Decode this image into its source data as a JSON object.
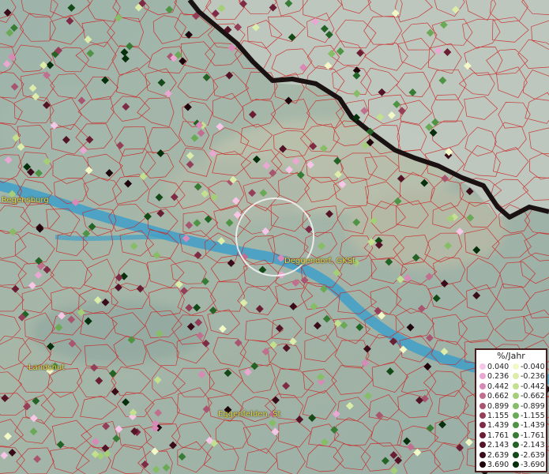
{
  "places": [
    {
      "name": "Regensburg"
    },
    {
      "name": "Deggendorf, GKSt"
    },
    {
      "name": "Landshut"
    },
    {
      "name": "Eggenfelden, St"
    }
  ],
  "legend": {
    "title": "%/Jahr",
    "positive": [
      {
        "value": "0.040",
        "color": "#f5c6e6"
      },
      {
        "value": "0.236",
        "color": "#e8a8d2"
      },
      {
        "value": "0.442",
        "color": "#d88ab6"
      },
      {
        "value": "0.662",
        "color": "#c0708f"
      },
      {
        "value": "0.899",
        "color": "#a85670"
      },
      {
        "value": "1.155",
        "color": "#943e58"
      },
      {
        "value": "1.439",
        "color": "#7e2b45"
      },
      {
        "value": "1.761",
        "color": "#6a1e34"
      },
      {
        "value": "2.143",
        "color": "#521426"
      },
      {
        "value": "2.639",
        "color": "#3a0c19"
      },
      {
        "value": "3.690",
        "color": "#1f050c"
      }
    ],
    "negative": [
      {
        "value": "-0.040",
        "color": "#f2f8c6"
      },
      {
        "value": "-0.236",
        "color": "#dcedaa"
      },
      {
        "value": "-0.442",
        "color": "#c2e08e"
      },
      {
        "value": "-0.662",
        "color": "#a4cf78"
      },
      {
        "value": "-0.899",
        "color": "#86bd66"
      },
      {
        "value": "-1.155",
        "color": "#6aa955"
      },
      {
        "value": "-1.439",
        "color": "#4e9444"
      },
      {
        "value": "-1.761",
        "color": "#377c34"
      },
      {
        "value": "-2.143",
        "color": "#236326"
      },
      {
        "value": "-2.639",
        "color": "#134a18"
      },
      {
        "value": "-3.690",
        "color": "#06300b"
      }
    ]
  },
  "colors": {
    "border": "#cc2020",
    "river": "#3f9fc8",
    "national_border": "#1a1212"
  }
}
